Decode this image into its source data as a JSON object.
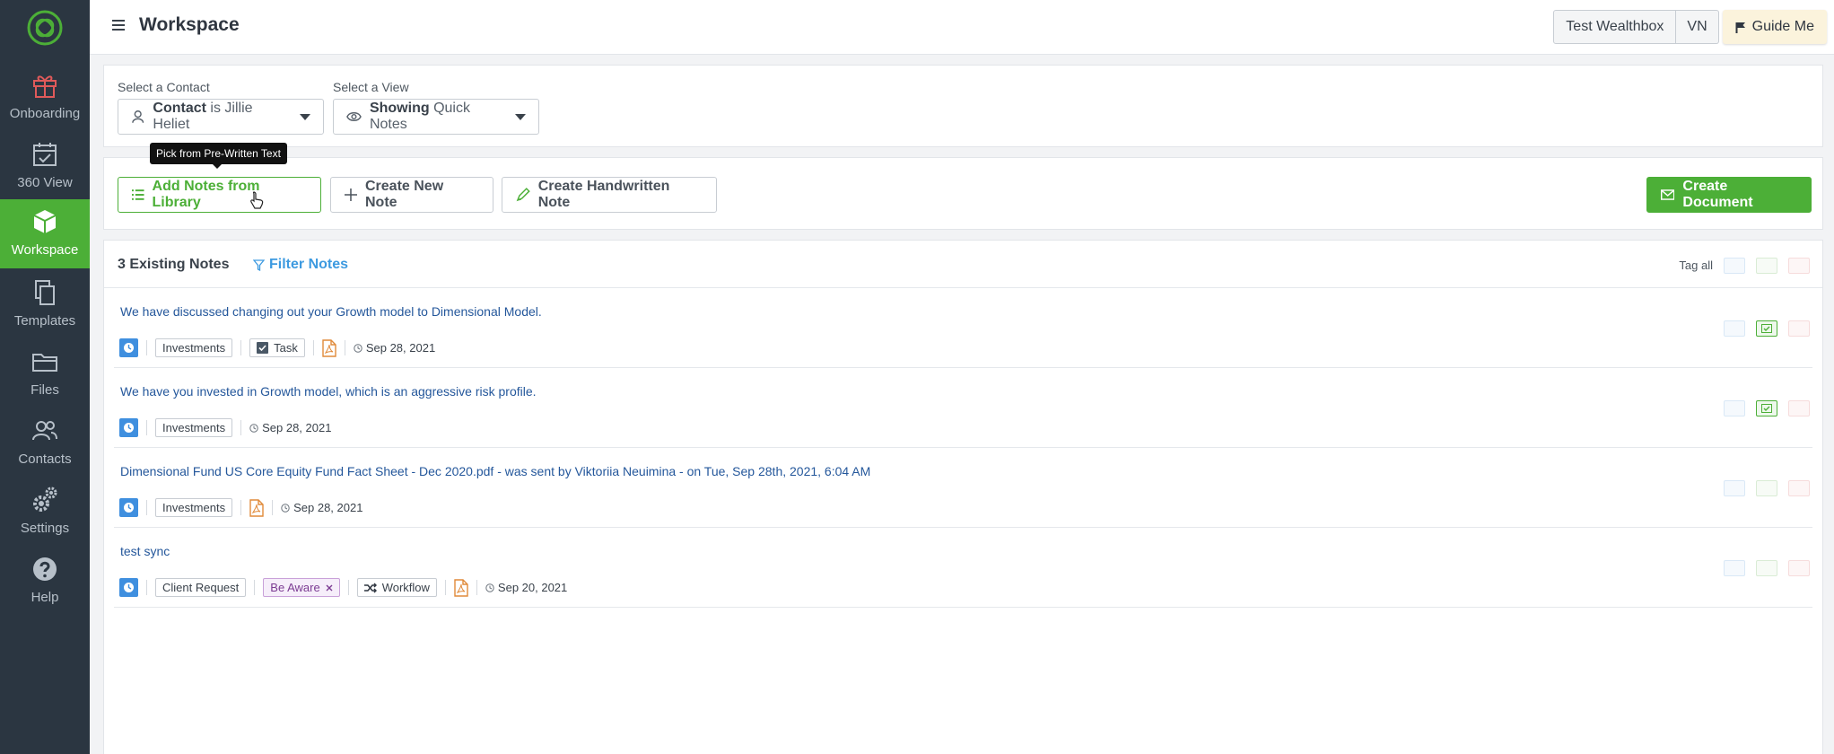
{
  "sidebar": {
    "items": [
      {
        "label": "Onboarding",
        "icon": "gift-icon"
      },
      {
        "label": "360 View",
        "icon": "calendar-icon"
      },
      {
        "label": "Workspace",
        "icon": "cube-icon",
        "active": true
      },
      {
        "label": "Templates",
        "icon": "copy-icon"
      },
      {
        "label": "Files",
        "icon": "folder-icon"
      },
      {
        "label": "Contacts",
        "icon": "users-icon"
      },
      {
        "label": "Settings",
        "icon": "gears-icon"
      },
      {
        "label": "Help",
        "icon": "help-icon"
      }
    ]
  },
  "header": {
    "title": "Workspace",
    "crm_button": "Test Wealthbox",
    "user_button": "VN",
    "guide_button": "Guide Me"
  },
  "filters": {
    "contact_label": "Select a Contact",
    "contact_prefix": "Contact",
    "contact_value": "is Jillie Heliet",
    "view_label": "Select a View",
    "view_prefix": "Showing",
    "view_value": "Quick Notes"
  },
  "actions": {
    "tooltip": "Pick from Pre-Written Text",
    "library": "Add Notes from Library",
    "new_note": "Create New Note",
    "handwritten": "Create Handwritten Note",
    "create_document": "Create Document"
  },
  "notes_panel": {
    "count_label": "3 Existing Notes",
    "filter_label": "Filter Notes",
    "tag_all_label": "Tag all"
  },
  "notes": [
    {
      "title": "We have discussed changing out your Growth model to Dimensional Model.",
      "tag": "Investments",
      "task": "Task",
      "date": "Sep 28, 2021"
    },
    {
      "title": "We have you invested in Growth model, which is an aggressive risk profile.",
      "tag": "Investments",
      "date": "Sep 28, 2021"
    },
    {
      "title": "Dimensional Fund US Core Equity Fund Fact Sheet - Dec 2020.pdf - was sent by Viktoriia Neuimina - on Tue, Sep 28th, 2021, 6:04 AM",
      "tag": "Investments",
      "date": "Sep 28, 2021"
    },
    {
      "title": "test sync",
      "tag": "Client Request",
      "aware": "Be Aware",
      "workflow": "Workflow",
      "date": "Sep 20, 2021"
    }
  ],
  "colors": {
    "sidebar_bg": "#2b3641",
    "accent_green": "#4caf37",
    "link_blue": "#3d9ae0",
    "note_title": "#24579b"
  }
}
